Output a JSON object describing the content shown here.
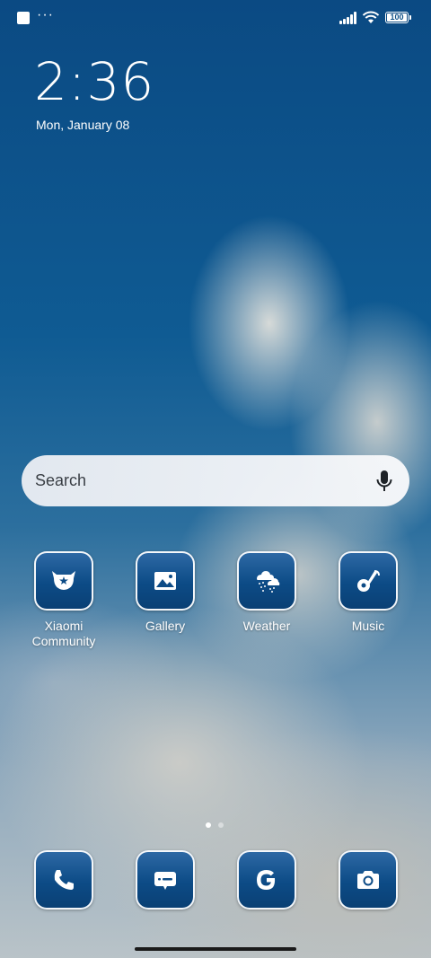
{
  "status_bar": {
    "overflow_dots": "···",
    "battery_level": "100"
  },
  "clock": {
    "time": "2:36",
    "date": "Mon, January 08"
  },
  "search": {
    "placeholder": "Search"
  },
  "apps": [
    {
      "label": "Xiaomi\nCommunity",
      "icon": "xiaomi-community-icon"
    },
    {
      "label": "Gallery",
      "icon": "gallery-icon"
    },
    {
      "label": "Weather",
      "icon": "weather-icon"
    },
    {
      "label": "Music",
      "icon": "music-icon"
    }
  ],
  "app_labels": {
    "xiaomi_community": "Xiaomi Community",
    "gallery": "Gallery",
    "weather": "Weather",
    "music": "Music"
  },
  "dock": [
    {
      "icon": "phone-icon"
    },
    {
      "icon": "messages-icon"
    },
    {
      "icon": "google-icon"
    },
    {
      "icon": "camera-icon"
    }
  ],
  "pager": {
    "pages": 2,
    "active": 1
  },
  "colors": {
    "icon_tile": "#0c4b86",
    "icon_border": "#ffffff",
    "text": "#ffffff"
  }
}
